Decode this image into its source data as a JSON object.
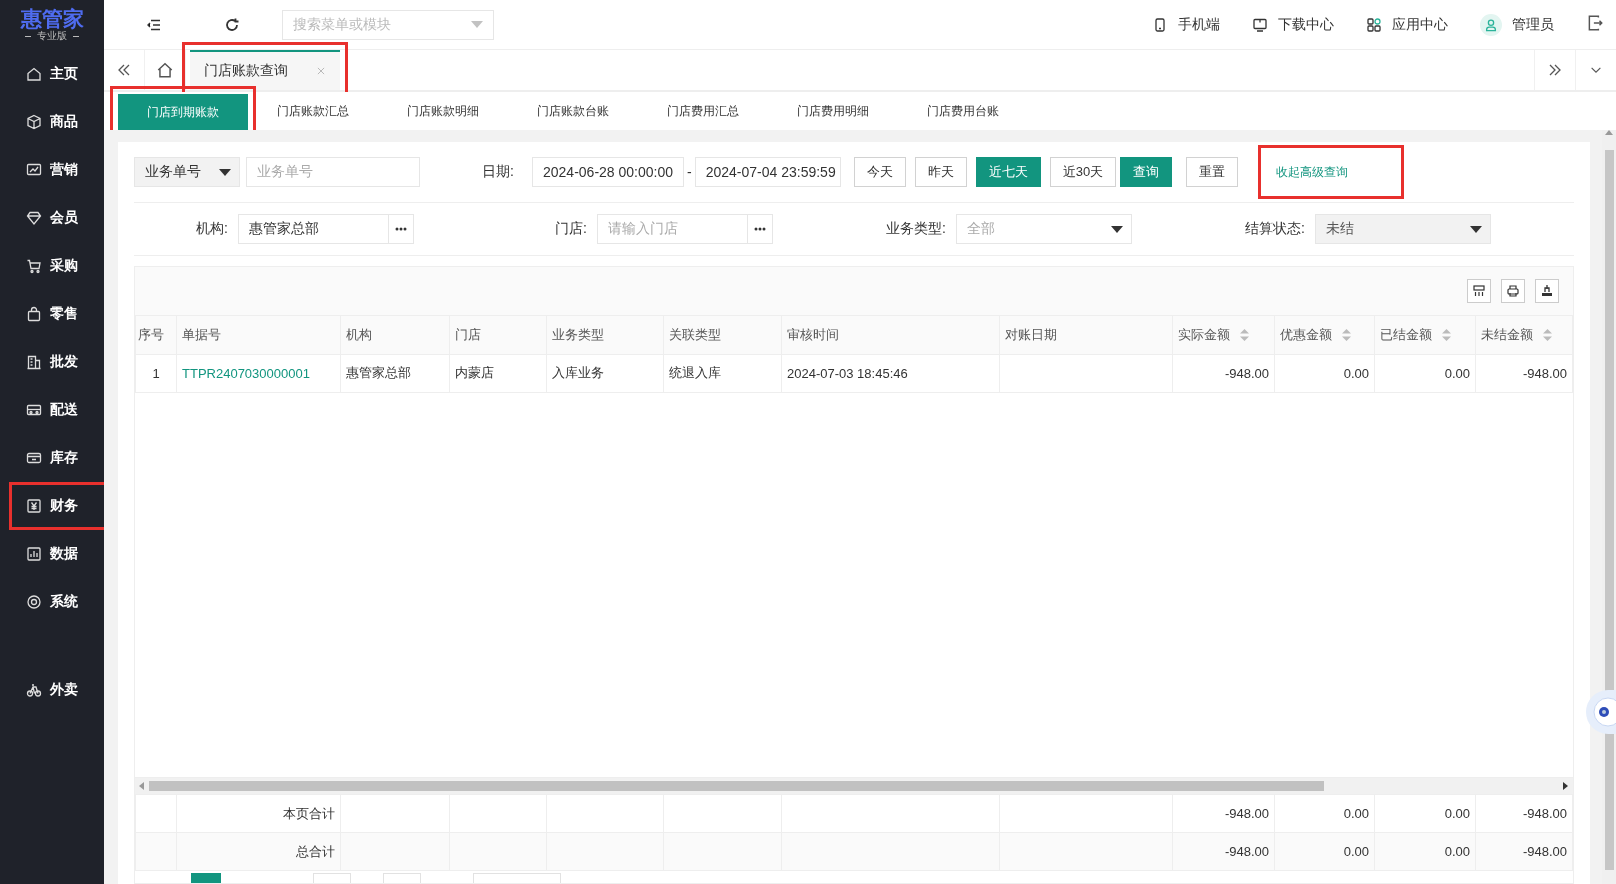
{
  "logo": {
    "name": "惠管家",
    "edition": "专业版"
  },
  "sidebar": {
    "items": [
      {
        "label": "主页",
        "highlighted": false
      },
      {
        "label": "商品",
        "highlighted": false
      },
      {
        "label": "营销",
        "highlighted": false
      },
      {
        "label": "会员",
        "highlighted": false
      },
      {
        "label": "采购",
        "highlighted": false
      },
      {
        "label": "零售",
        "highlighted": false
      },
      {
        "label": "批发",
        "highlighted": false
      },
      {
        "label": "配送",
        "highlighted": false
      },
      {
        "label": "库存",
        "highlighted": false
      },
      {
        "label": "财务",
        "highlighted": true
      },
      {
        "label": "数据",
        "highlighted": false
      },
      {
        "label": "系统",
        "highlighted": false
      }
    ],
    "extra_items": [
      {
        "label": "外卖",
        "highlighted": false
      }
    ]
  },
  "topbar": {
    "search": {
      "placeholder": "搜索菜单或模块"
    },
    "links": [
      "手机端",
      "下载中心",
      "应用中心"
    ],
    "user": "管理员"
  },
  "page_tabs": [
    {
      "label": "门店账款查询",
      "selected": true,
      "highlighted": true
    }
  ],
  "sub_tabs": [
    {
      "label": "门店到期账款",
      "selected": true,
      "highlighted": true
    },
    {
      "label": "门店账款汇总",
      "selected": false,
      "highlighted": false
    },
    {
      "label": "门店账款明细",
      "selected": false,
      "highlighted": false
    },
    {
      "label": "门店账款台账",
      "selected": false,
      "highlighted": false
    },
    {
      "label": "门店费用汇总",
      "selected": false,
      "highlighted": false
    },
    {
      "label": "门店费用明细",
      "selected": false,
      "highlighted": false
    },
    {
      "label": "门店费用台账",
      "selected": false,
      "highlighted": false
    }
  ],
  "filters": {
    "doc_type": "业务单号",
    "doc_no": {
      "placeholder": "业务单号"
    },
    "date_label": "日期:",
    "date_from": "2024-06-28 00:00:00",
    "date_sep": "-",
    "date_to": "2024-07-04 23:59:59",
    "quick_ranges": [
      {
        "label": "今天",
        "selected": false
      },
      {
        "label": "昨天",
        "selected": false
      },
      {
        "label": "近七天",
        "selected": true
      },
      {
        "label": "近30天",
        "selected": false
      }
    ],
    "query_button": "查询",
    "reset_button": "重置",
    "toggle_link": {
      "label": "收起高级查询",
      "highlighted": true
    },
    "fields": [
      {
        "label": "机构:",
        "kind": "picker",
        "value": "惠管家总部"
      },
      {
        "label": "门店:",
        "kind": "picker",
        "placeholder": "请输入门店"
      },
      {
        "label": "业务类型:",
        "kind": "select",
        "placeholder": "全部",
        "disabled": false
      },
      {
        "label": "结算状态:",
        "kind": "select",
        "value": "未结",
        "disabled": true
      }
    ]
  },
  "table": {
    "columns": [
      {
        "label": "序号",
        "kind": "index",
        "sortable": false
      },
      {
        "label": "单据号",
        "kind": "link",
        "sortable": false
      },
      {
        "label": "机构",
        "kind": "text",
        "sortable": false
      },
      {
        "label": "门店",
        "kind": "text",
        "sortable": false
      },
      {
        "label": "业务类型",
        "kind": "text",
        "sortable": false
      },
      {
        "label": "关联类型",
        "kind": "text",
        "sortable": false
      },
      {
        "label": "审核时间",
        "kind": "text",
        "sortable": false
      },
      {
        "label": "对账日期",
        "kind": "text",
        "sortable": false
      },
      {
        "label": "实际金额",
        "kind": "amount",
        "sortable": true
      },
      {
        "label": "优惠金额",
        "kind": "amount",
        "sortable": true
      },
      {
        "label": "已结金额",
        "kind": "amount",
        "sortable": true
      },
      {
        "label": "未结金额",
        "kind": "amount",
        "sortable": true
      }
    ],
    "rows": [
      [
        "1",
        "TTPR2407030000001",
        "惠管家总部",
        "内蒙店",
        "入库业务",
        "统退入库",
        "2024-07-03 18:45:46",
        null,
        "-948.00",
        "0.00",
        "0.00",
        "-948.00"
      ]
    ],
    "totals": [
      {
        "label": "本页合计",
        "values": [
          "-948.00",
          "0.00",
          "0.00",
          "-948.00"
        ]
      },
      {
        "label": "总合计",
        "values": [
          "-948.00",
          "0.00",
          "0.00",
          "-948.00"
        ]
      }
    ]
  }
}
